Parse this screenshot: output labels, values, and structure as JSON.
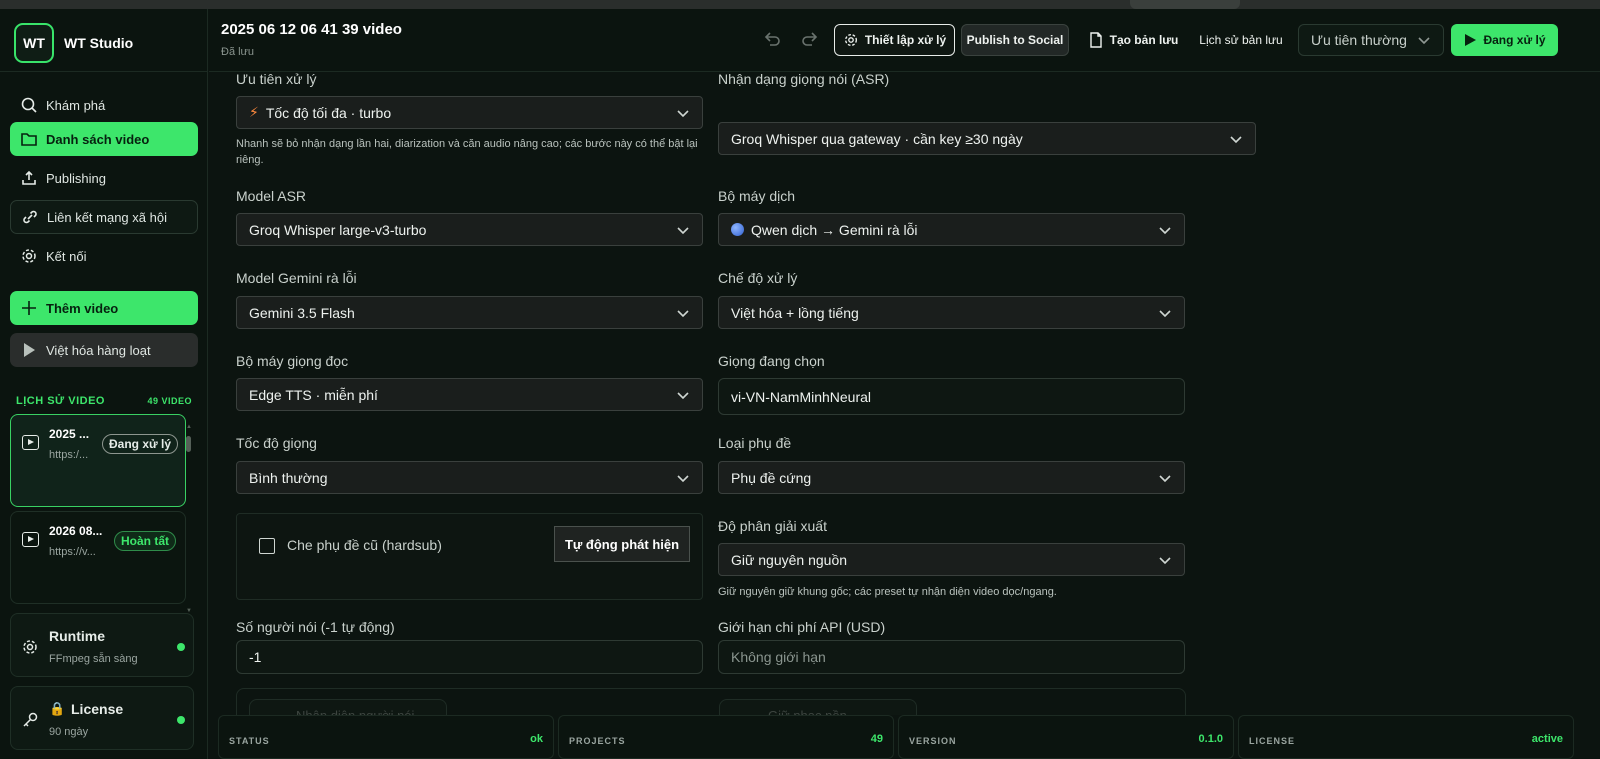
{
  "app": {
    "name": "WT Studio",
    "logo_text": "WT"
  },
  "sidebar": {
    "nav": [
      {
        "label": "Khám phá",
        "icon": "search-icon"
      },
      {
        "label": "Danh sách video",
        "icon": "folder-icon"
      },
      {
        "label": "Publishing",
        "icon": "share-icon"
      },
      {
        "label": "Liên kết mạng xã hội",
        "icon": "link-icon"
      },
      {
        "label": "Kết nối",
        "icon": "gear-icon"
      }
    ],
    "add_video": "Thêm video",
    "batch": "Việt hóa hàng loạt",
    "history_title": "LỊCH SỬ VIDEO",
    "history_count": "49 VIDEO",
    "videos": [
      {
        "title": "2025 ...",
        "url": "https:/...",
        "status": "Đang xử lý"
      },
      {
        "title": "2026 08...",
        "url": "https://v...",
        "status": "Hoàn tất"
      }
    ],
    "runtime": {
      "title": "Runtime",
      "sub": "FFmpeg sẵn sàng"
    },
    "license": {
      "title": "License",
      "sub": "90 ngày"
    }
  },
  "header": {
    "title": "2025 06 12 06 41 39 video",
    "subtitle": "Đã lưu",
    "settings_btn": "Thiết lập xử lý",
    "publish_btn": "Publish to Social",
    "save_btn": "Tạo bản lưu",
    "history_btn": "Lịch sử bản lưu",
    "priority_select": "Ưu tiên thường",
    "processing_btn": "Đang xử lý"
  },
  "form": {
    "priority": {
      "label": "Ưu tiên xử lý",
      "value": "Tốc độ tối đa · turbo",
      "help": "Nhanh sẽ bỏ nhận dạng lần hai, diarization và căn audio nâng cao; các bước này có thể bật lại riêng."
    },
    "asr_engine": {
      "label": "Nhận dạng giọng nói (ASR)",
      "value": "Groq Whisper qua gateway · cần key ≥30 ngày"
    },
    "asr_model": {
      "label": "Model ASR",
      "value": "Groq Whisper large-v3-turbo"
    },
    "translator": {
      "label": "Bộ máy dịch",
      "value": "Qwen dịch → Gemini rà lỗi"
    },
    "gemini_model": {
      "label": "Model Gemini rà lỗi",
      "value": "Gemini 3.5 Flash"
    },
    "mode": {
      "label": "Chế độ xử lý",
      "value": "Việt hóa + lồng tiếng"
    },
    "tts_engine": {
      "label": "Bộ máy giọng đọc",
      "value": "Edge TTS · miễn phí"
    },
    "voice": {
      "label": "Giọng đang chọn",
      "value": "vi-VN-NamMinhNeural"
    },
    "speed": {
      "label": "Tốc độ giọng",
      "value": "Bình thường"
    },
    "sub_type": {
      "label": "Loại phụ đề",
      "value": "Phụ đề cứng"
    },
    "hardsub": {
      "label": "Che phụ đề cũ (hardsub)",
      "button": "Tự động phát hiện"
    },
    "resolution": {
      "label": "Độ phân giải xuất",
      "value": "Giữ nguyên nguồn",
      "help": "Giữ nguyên giữ khung gốc; các preset tự nhận diện video dọc/ngang."
    },
    "speakers": {
      "label": "Số người nói (-1 tự động)",
      "value": "-1"
    },
    "cost_limit": {
      "label": "Giới hạn chi phí API (USD)",
      "placeholder": "Không giới hạn"
    },
    "partial_left": "Nhận diện người nói",
    "partial_right": "Giữ nhạc nền"
  },
  "statusbar": [
    {
      "key": "STATUS",
      "value": "ok"
    },
    {
      "key": "PROJECTS",
      "value": "49"
    },
    {
      "key": "VERSION",
      "value": "0.1.0"
    },
    {
      "key": "LICENSE",
      "value": "active"
    }
  ],
  "colors": {
    "accent": "#3de66b",
    "bg": "#0c1410",
    "field": "#1a1e1c"
  }
}
